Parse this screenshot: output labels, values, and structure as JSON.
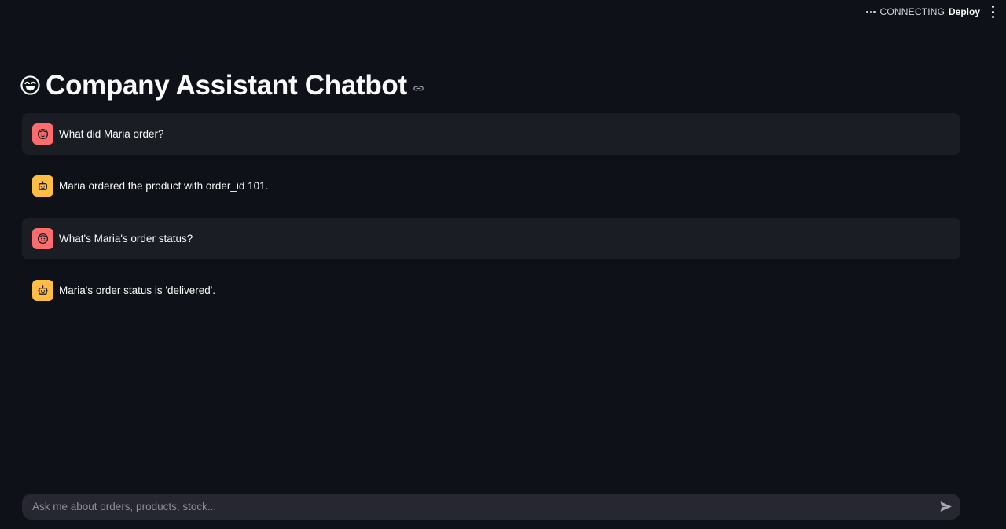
{
  "header": {
    "status_text": "CONNECTING",
    "deploy_label": "Deploy",
    "status_icon": "ellipsis-icon",
    "menu_icon": "kebab-menu-icon"
  },
  "page": {
    "title": "Company Assistant Chatbot",
    "title_icon": "smiling-face-icon",
    "anchor_icon": "link-icon"
  },
  "messages": [
    {
      "role": "user",
      "text": "What did Maria order?",
      "avatar_icon": "user-face-icon"
    },
    {
      "role": "assistant",
      "text": "Maria ordered the product with order_id 101.",
      "avatar_icon": "robot-icon"
    },
    {
      "role": "user",
      "text": "What's Maria's order status?",
      "avatar_icon": "user-face-icon"
    },
    {
      "role": "assistant",
      "text": "Maria's order status is 'delivered'.",
      "avatar_icon": "robot-icon"
    }
  ],
  "chat_input": {
    "value": "",
    "placeholder": "Ask me about orders, products, stock...",
    "send_icon": "send-icon"
  },
  "colors": {
    "background": "#0e1117",
    "user_message_bg": "#1b1d25",
    "user_avatar": "#ff6c6c",
    "assistant_avatar": "#ffbd45",
    "input_bg": "#262730",
    "text": "#fafafa"
  }
}
